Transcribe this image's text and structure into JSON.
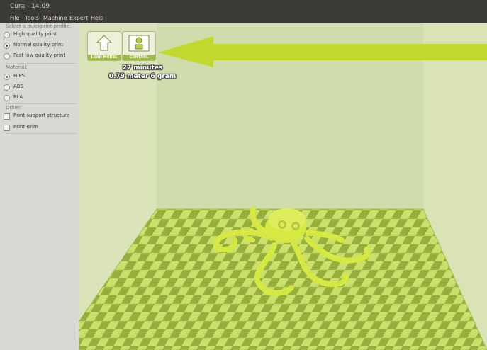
{
  "window": {
    "title": "Cura - 14.09"
  },
  "menu": [
    "File",
    "Tools",
    "Machine",
    "Expert",
    "Help"
  ],
  "sidebar": {
    "profile_title": "Select a quickprint profile:",
    "profiles": [
      "High quality print",
      "Normal quality print",
      "Fast low quality print"
    ],
    "selected_profile": "Normal quality print",
    "material_title": "Material:",
    "materials": [
      "HIPS",
      "ABS",
      "PLA"
    ],
    "selected_material": "HIPS",
    "other_title": "Other:",
    "other": [
      "Print support structure",
      "Print Brim"
    ]
  },
  "toolbar": {
    "load_label": "LOAD MODEL",
    "control_label": "CONTROL"
  },
  "print_info": {
    "time": "27 minutes",
    "usage": "0.79 meter 6 gram"
  },
  "colors": {
    "accent": "#c2d82f",
    "model": "#d6e842",
    "bed_light": "#cbe06a",
    "bed_dark": "#8fa83a"
  }
}
